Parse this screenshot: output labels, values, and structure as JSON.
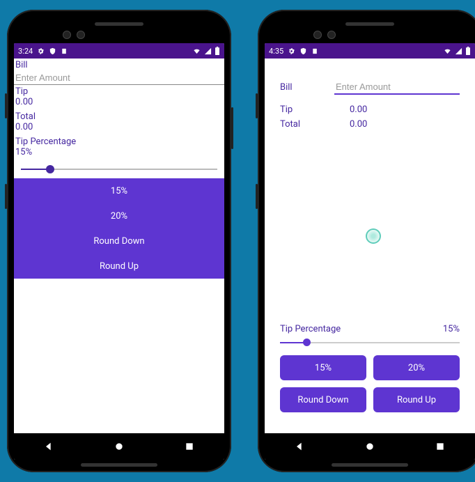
{
  "left": {
    "status": {
      "time": "3:24"
    },
    "bill_label": "Bill",
    "bill_placeholder": "Enter Amount",
    "tip_label": "Tip",
    "tip_value": "0.00",
    "total_label": "Total",
    "total_value": "0.00",
    "tip_pct_label": "Tip Percentage",
    "tip_pct_value": "15%",
    "slider_pct": 0.15,
    "buttons": {
      "b15": "15%",
      "b20": "20%",
      "rdown": "Round Down",
      "rup": "Round Up"
    }
  },
  "right": {
    "status": {
      "time": "4:35"
    },
    "bill_label": "Bill",
    "bill_placeholder": "Enter Amount",
    "tip_label": "Tip",
    "tip_value": "0.00",
    "total_label": "Total",
    "total_value": "0.00",
    "tip_pct_label": "Tip Percentage",
    "tip_pct_value": "15%",
    "slider_pct": 0.15,
    "buttons": {
      "b15": "15%",
      "b20": "20%",
      "rdown": "Round Down",
      "rup": "Round Up"
    }
  }
}
